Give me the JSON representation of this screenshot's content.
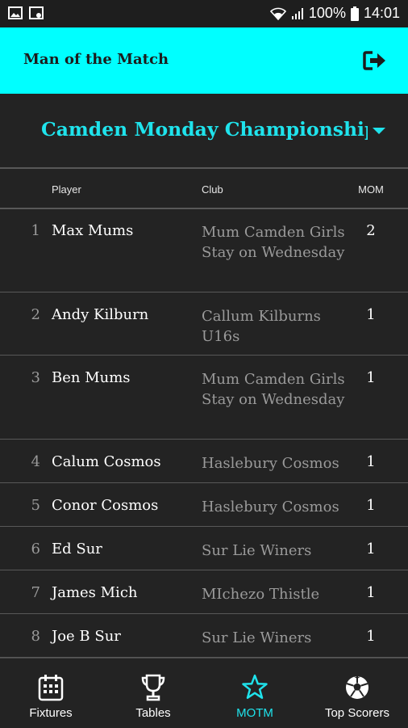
{
  "status_bar": {
    "battery": "100%",
    "time": "14:01"
  },
  "app_bar": {
    "title": "Man of the Match"
  },
  "competition": {
    "name": "Camden Monday Championship"
  },
  "table": {
    "headers": {
      "player": "Player",
      "club": "Club",
      "mom": "MOM"
    },
    "rows": [
      {
        "rank": "1",
        "player": "Max Mums",
        "club": "Mum Camden Girls Stay on Wednesday",
        "mom": "2"
      },
      {
        "rank": "2",
        "player": "Andy Kilburn",
        "club": "Callum Kilburns U16s",
        "mom": "1"
      },
      {
        "rank": "3",
        "player": "Ben Mums",
        "club": "Mum Camden Girls Stay on Wednesday",
        "mom": "1"
      },
      {
        "rank": "4",
        "player": "Calum Cosmos",
        "club": "Haslebury Cosmos",
        "mom": "1"
      },
      {
        "rank": "5",
        "player": "Conor Cosmos",
        "club": "Haslebury Cosmos",
        "mom": "1"
      },
      {
        "rank": "6",
        "player": "Ed Sur",
        "club": "Sur Lie Winers",
        "mom": "1"
      },
      {
        "rank": "7",
        "player": "James Mich",
        "club": "MIchezo Thistle",
        "mom": "1"
      },
      {
        "rank": "8",
        "player": "Joe B Sur",
        "club": "Sur Lie Winers",
        "mom": "1"
      }
    ]
  },
  "bottom_nav": {
    "items": [
      {
        "label": "Fixtures",
        "icon": "calendar-icon"
      },
      {
        "label": "Tables",
        "icon": "trophy-icon"
      },
      {
        "label": "MOTM",
        "icon": "star-icon"
      },
      {
        "label": "Top Scorers",
        "icon": "football-icon"
      }
    ],
    "active": "MOTM"
  },
  "colors": {
    "accent": "#00ffff",
    "accent_text": "#1fe3ec",
    "background": "#232323",
    "muted_text": "#9a9a9a"
  }
}
